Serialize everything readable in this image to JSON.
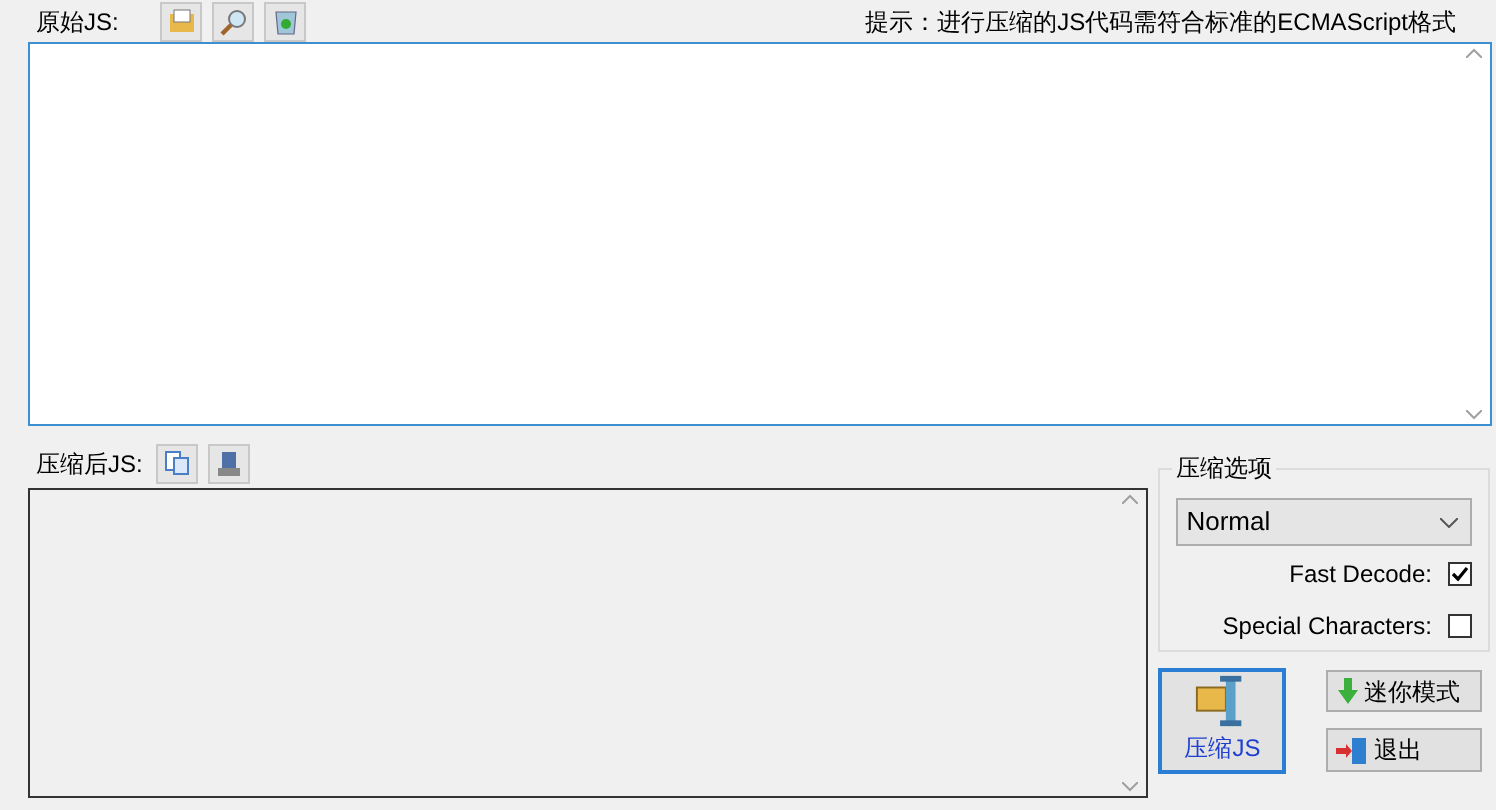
{
  "source": {
    "label": "原始JS:",
    "hint": "提示：进行压缩的JS代码需符合标准的ECMAScript格式"
  },
  "output": {
    "label": "压缩后JS:"
  },
  "options": {
    "title": "压缩选项",
    "mode": "Normal",
    "checks": [
      {
        "label": "Fast Decode:",
        "checked": true
      },
      {
        "label": "Special Characters:",
        "checked": false
      }
    ]
  },
  "compress_button": "压缩JS",
  "mini_button": "迷你模式",
  "exit_button": "退出"
}
